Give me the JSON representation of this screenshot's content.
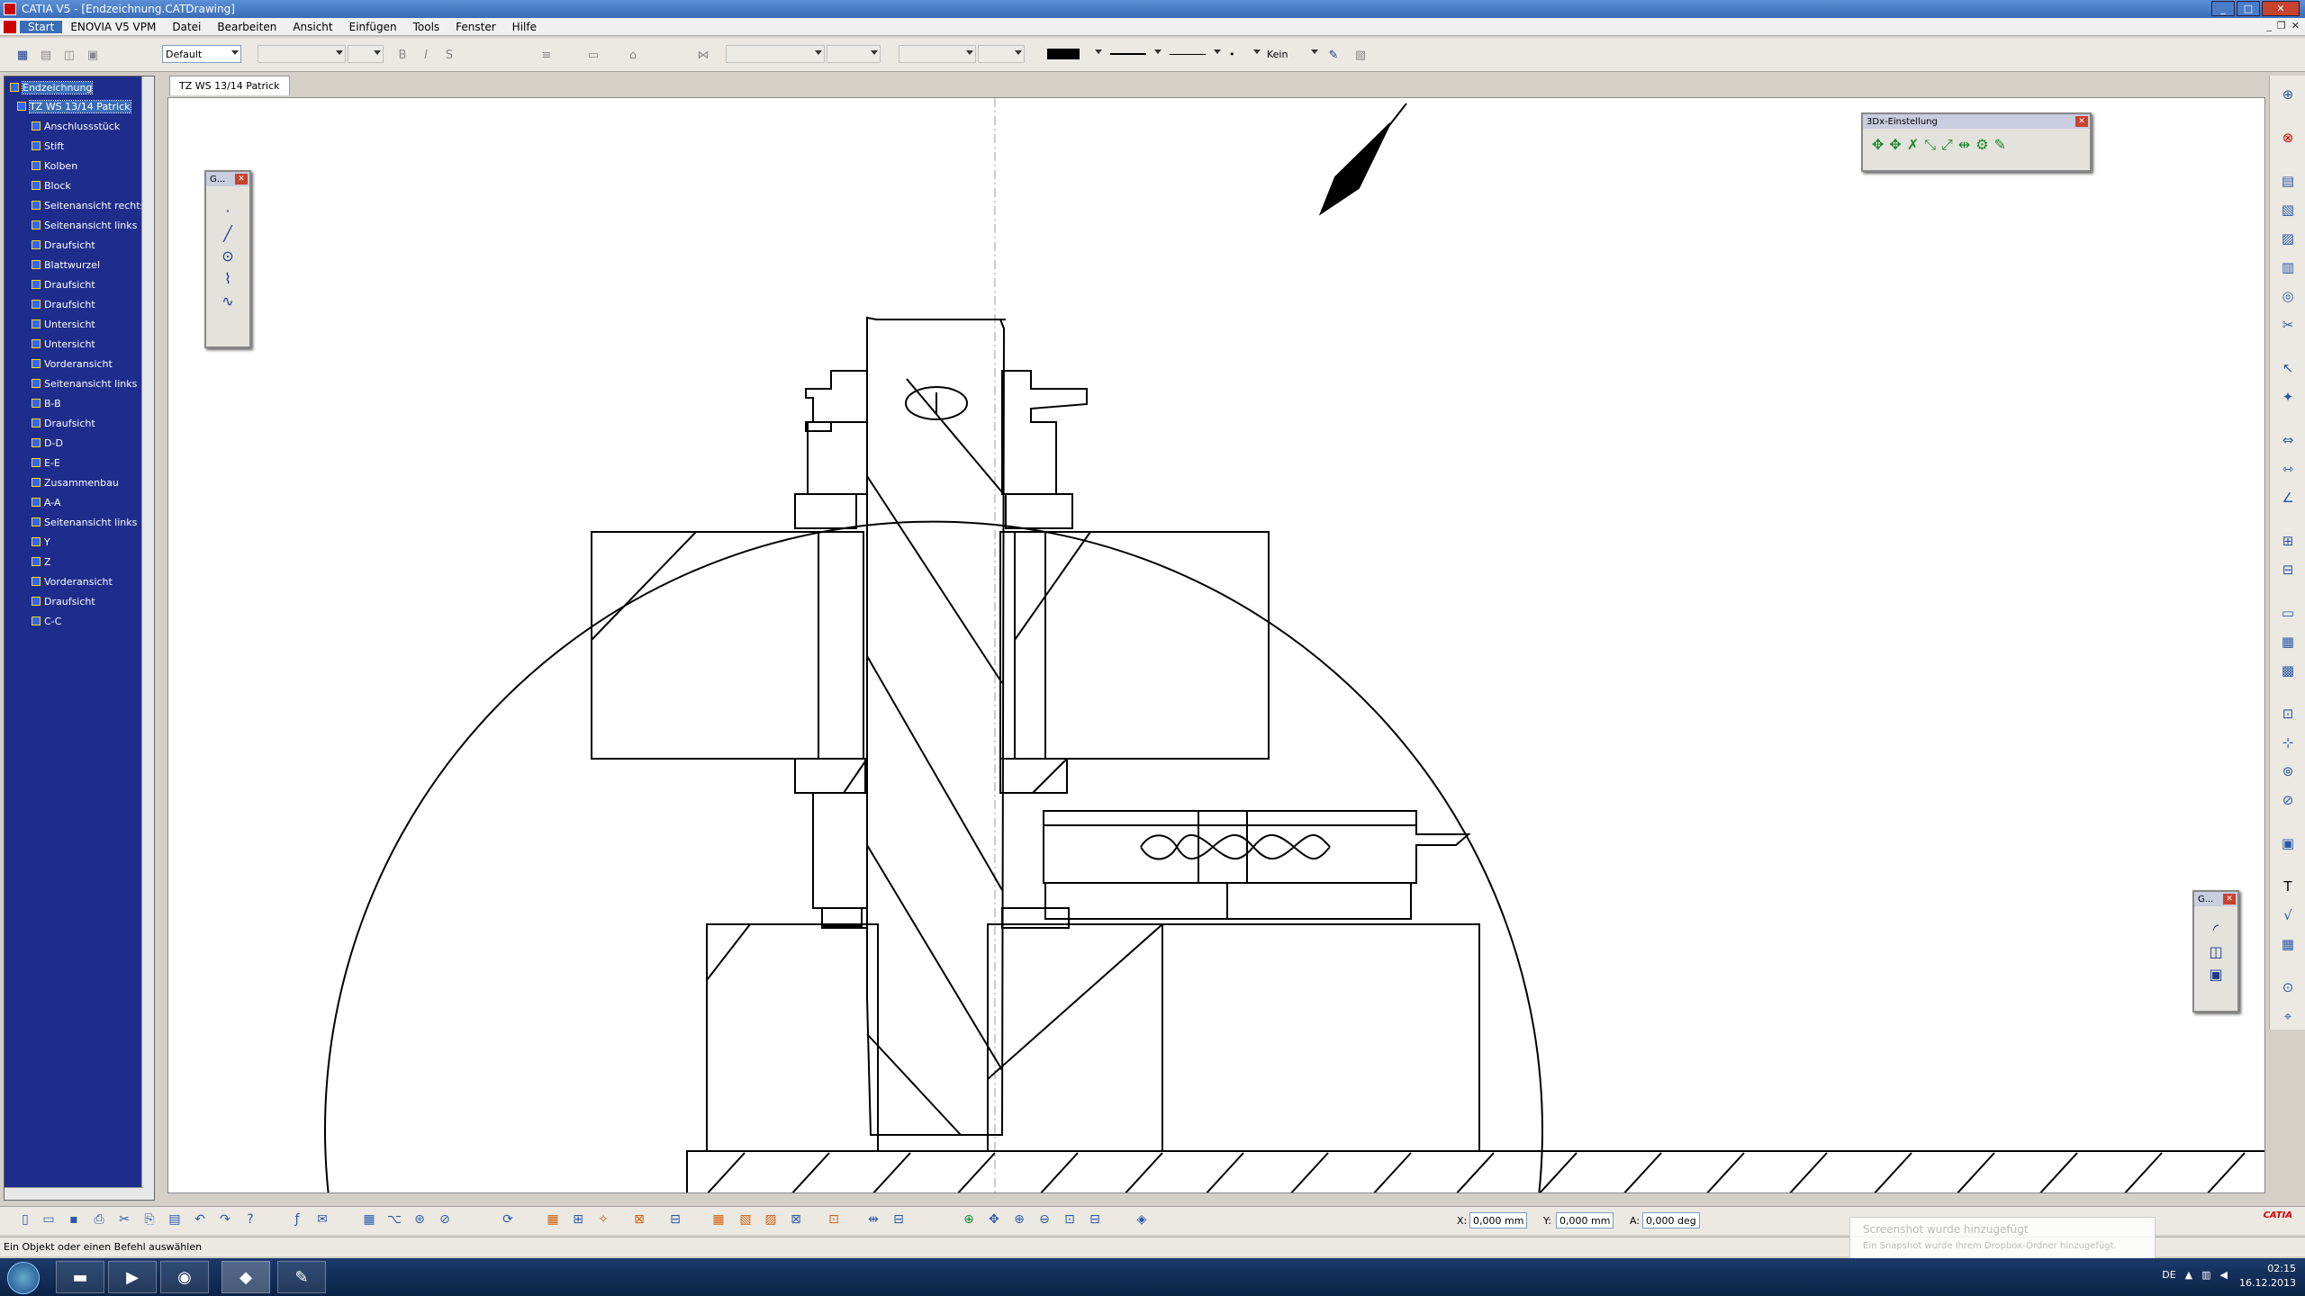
{
  "window": {
    "title": "CATIA V5 - [Endzeichnung.CATDrawing]",
    "min": "_",
    "max": "□",
    "close": "✕"
  },
  "menu": {
    "items": [
      "Start",
      "ENOVIA V5 VPM",
      "Datei",
      "Bearbeiten",
      "Ansicht",
      "Einfügen",
      "Tools",
      "Fenster",
      "Hilfe"
    ]
  },
  "toolbar": {
    "style_value": "Default",
    "font_bold": "B",
    "font_italic": "I",
    "font_strike": "S",
    "line_thickness_value": "•",
    "pattern_value": "Kein"
  },
  "tree": {
    "root": "Endzeichnung",
    "sheet": "TZ WS 13/14 Patrick",
    "items": [
      "Anschlussstück",
      "Stift",
      "Kolben",
      "Block",
      "Seitenansicht rechts",
      "Seitenansicht links",
      "Draufsicht",
      "Blattwurzel",
      "Draufsicht",
      "Draufsicht",
      "Untersicht",
      "Untersicht",
      "Vorderansicht",
      "Seitenansicht links",
      "B-B",
      "Draufsicht",
      "D-D",
      "E-E",
      "Zusammenbau",
      "A-A",
      "Seitenansicht links",
      "Y",
      "Z",
      "Vorderansicht",
      "Draufsicht",
      "C-C"
    ]
  },
  "tab": {
    "label": "TZ WS 13/14 Patrick"
  },
  "palettes": {
    "geometry_title": "G...",
    "geometry2_title": "G...",
    "spacemouse_title": "3Dx-Einstellung"
  },
  "coords": {
    "x_label": "X:",
    "x_value": "0,000 mm",
    "y_label": "Y:",
    "y_value": "0,000 mm",
    "a_label": "A:",
    "a_value": "0,000 deg"
  },
  "status": {
    "text": "Ein Objekt oder einen Befehl auswählen"
  },
  "notification": {
    "title": "Screenshot wurde hinzugefügt",
    "body": "Ein Snapshot wurde Ihrem Dropbox-Ordner hinzugefügt."
  },
  "taskbar": {
    "lang": "DE",
    "time": "02:15",
    "date": "16.12.2013",
    "catia_logo": "CATIA"
  },
  "icons": {
    "start": "start-orb-icon",
    "explorer": "folder-icon",
    "media": "media-player-icon",
    "firefox": "firefox-icon",
    "catia": "catia-app-icon",
    "acrobat": "pdf-icon"
  }
}
